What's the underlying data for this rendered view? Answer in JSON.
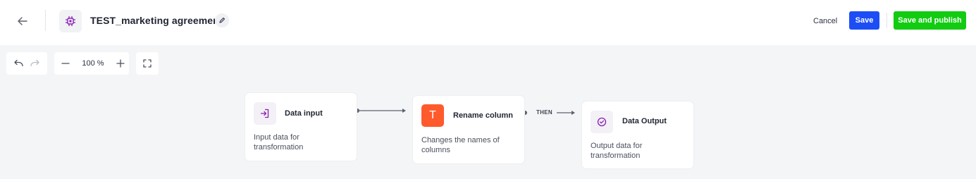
{
  "header": {
    "title": "TEST_marketing agreement",
    "cancel_label": "Cancel",
    "save_label": "Save",
    "publish_label": "Save and publish"
  },
  "toolbar": {
    "zoom_level": "100 %"
  },
  "nodes": [
    {
      "title": "Data input",
      "description": "Input data for transformation",
      "icon": "import-icon"
    },
    {
      "title": "Rename column",
      "description": "Changes the names of columns",
      "icon": "text-t-icon",
      "icon_glyph": "T"
    },
    {
      "title": "Data Output",
      "description": "Output data for transformation",
      "icon": "check-circle-icon"
    }
  ],
  "edges": [
    {
      "from": "Data input",
      "to": "Rename column",
      "label": ""
    },
    {
      "from": "Rename column",
      "to": "Data Output",
      "label": "THEN"
    }
  ],
  "colors": {
    "primary": "#1d4ef5",
    "publish": "#12cc12",
    "accent_purple": "#8a1fb5",
    "rename_node": "#ff5a2c",
    "canvas_bg": "#f4f5f7"
  }
}
